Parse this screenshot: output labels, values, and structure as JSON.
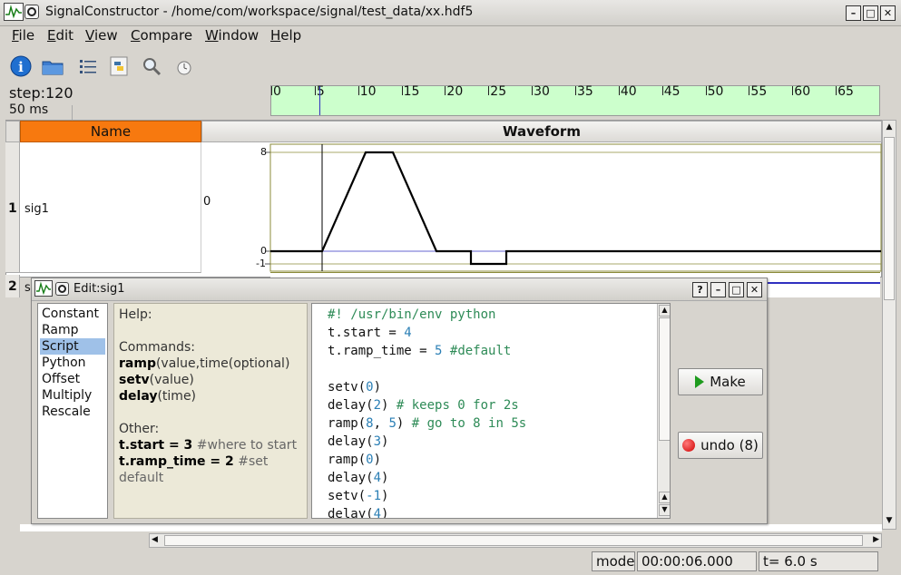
{
  "window": {
    "title": "SignalConstructor - /home/com/workspace/signal/test_data/xx.hdf5"
  },
  "menubar": [
    {
      "first": "F",
      "rest": "ile"
    },
    {
      "first": "E",
      "rest": "dit"
    },
    {
      "first": "V",
      "rest": "iew"
    },
    {
      "first": "C",
      "rest": "ompare"
    },
    {
      "first": "W",
      "rest": "indow"
    },
    {
      "first": "H",
      "rest": "elp"
    }
  ],
  "toolbar": [
    "info-icon",
    "open-folder-icon",
    "list-icon",
    "python-icon",
    "magnifier-icon",
    "clock-icon"
  ],
  "timeline": {
    "step_label": "step:120",
    "time_label": "50 ms",
    "ticks": [
      "0",
      "5",
      "10",
      "15",
      "20",
      "25",
      "30",
      "35",
      "40",
      "45",
      "50",
      "55",
      "60",
      "65"
    ],
    "cursor": 5.5,
    "background": "#ccffcc"
  },
  "table": {
    "headers": {
      "name": "Name",
      "waveform": "Waveform"
    },
    "rows": [
      {
        "num": "1",
        "name": "sig1",
        "value": "0",
        "axis_labels": {
          "top": "8",
          "zero": "0",
          "neg": "-1"
        }
      },
      {
        "num": "2",
        "name": "s"
      }
    ]
  },
  "dialog": {
    "title": "Edit:sig1",
    "modes": [
      "Constant",
      "Ramp",
      "Script",
      "Python",
      "Offset",
      "Multiply",
      "Rescale"
    ],
    "selected_mode": "Script",
    "help": {
      "heading": "Help:",
      "commands_heading": "Commands:",
      "commands": [
        {
          "name": "ramp",
          "args": "(value,time(optional)"
        },
        {
          "name": "setv",
          "args": "(value)"
        },
        {
          "name": "delay",
          "args": "(time)"
        }
      ],
      "other_heading": "Other:",
      "other": [
        {
          "code": "t.start = 3",
          "comment": " #where to start"
        },
        {
          "code": "t.ramp_time = 2",
          "comment": " #set default"
        }
      ]
    },
    "code_lines": [
      "#! /usr/bin/env python",
      "t.start = 4",
      "t.ramp_time = 5 #default",
      "",
      "setv(0)",
      "delay(2) # keeps 0 for 2s",
      "ramp(8, 5) # go to 8 in 5s",
      "delay(3)",
      "ramp(0)",
      "delay(4)",
      "setv(-1)",
      "delay(4)"
    ],
    "make_label": "Make",
    "undo_label": "undo (8)"
  },
  "status": {
    "mode": "mode",
    "time": "00:00:06.000",
    "t": "t= 6.0 s"
  },
  "colors": {
    "accent": "#f7790f",
    "plot_border": "#8b8b3a",
    "zero_line": "#3030c0"
  }
}
